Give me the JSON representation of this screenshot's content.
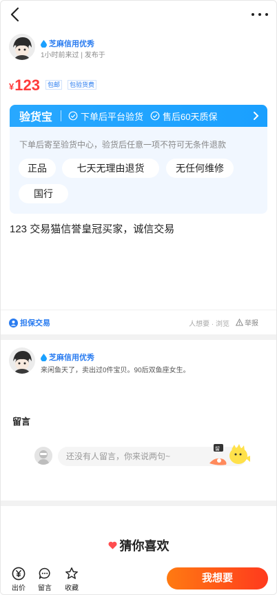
{
  "seller": {
    "credit_label": "芝麻信用优秀",
    "subtitle": "1小时前来过 | 发布于"
  },
  "price": {
    "symbol": "¥",
    "value": "123",
    "tags": [
      "包邮",
      "包验货费"
    ]
  },
  "inspection": {
    "title": "验货宝",
    "features": [
      "下单后平台验货",
      "售后60天质保"
    ],
    "description": "下单后寄至验货中心，验货后任意一项不符可无条件退款",
    "chips": [
      "正品",
      "七天无理由退货",
      "无任何维修",
      "国行"
    ]
  },
  "item_description": "123 交易猫信誉皇冠买家，诚信交易",
  "guarantee": {
    "label": "担保交易",
    "views": "人想要 · 浏览",
    "report": "举报"
  },
  "seller_card": {
    "credit_label": "芝麻信用优秀",
    "bio": "来闲鱼天了，卖出过0件宝贝。90后双鱼座女生。"
  },
  "messages": {
    "title": "留言",
    "placeholder": "还没有人留言，你来说两句~"
  },
  "recommend": {
    "title": "猜你喜欢"
  },
  "bottom_bar": {
    "items": [
      "出价",
      "留言",
      "收藏"
    ],
    "want_button": "我想要"
  },
  "colors": {
    "price_red": "#ff3b3b",
    "brand_blue": "#1aa0ff",
    "cta_orange": "#ff5a1d"
  }
}
